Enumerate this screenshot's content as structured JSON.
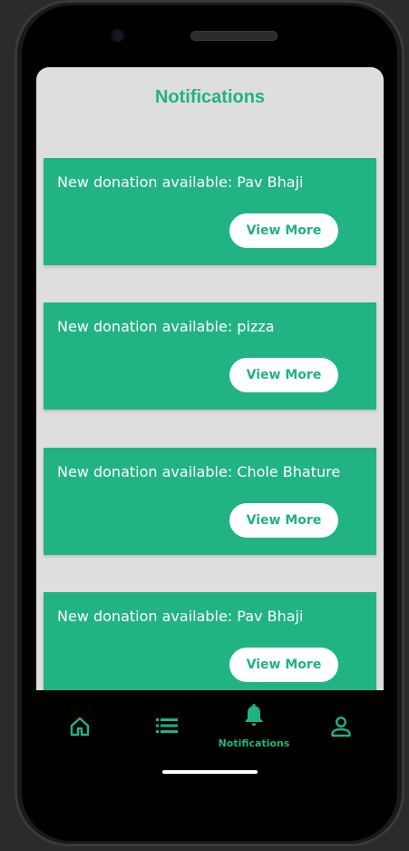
{
  "header": {
    "title": "Notifications"
  },
  "notifications": [
    {
      "text": "New donation available: Pav Bhaji",
      "button_label": "View More"
    },
    {
      "text": "New donation available: pizza",
      "button_label": "View More"
    },
    {
      "text": "New donation available: Chole Bhature",
      "button_label": "View More"
    },
    {
      "text": "New donation available: Pav Bhaji",
      "button_label": "View More"
    }
  ],
  "bottom_nav": {
    "items": [
      {
        "icon": "home-icon",
        "label": ""
      },
      {
        "icon": "list-icon",
        "label": ""
      },
      {
        "icon": "bell-icon",
        "label": "Notifications"
      },
      {
        "icon": "person-icon",
        "label": ""
      }
    ],
    "active_color": "#21b184"
  },
  "colors": {
    "accent": "#21b184",
    "card": "#22b384",
    "screen_bg": "#dedede"
  }
}
